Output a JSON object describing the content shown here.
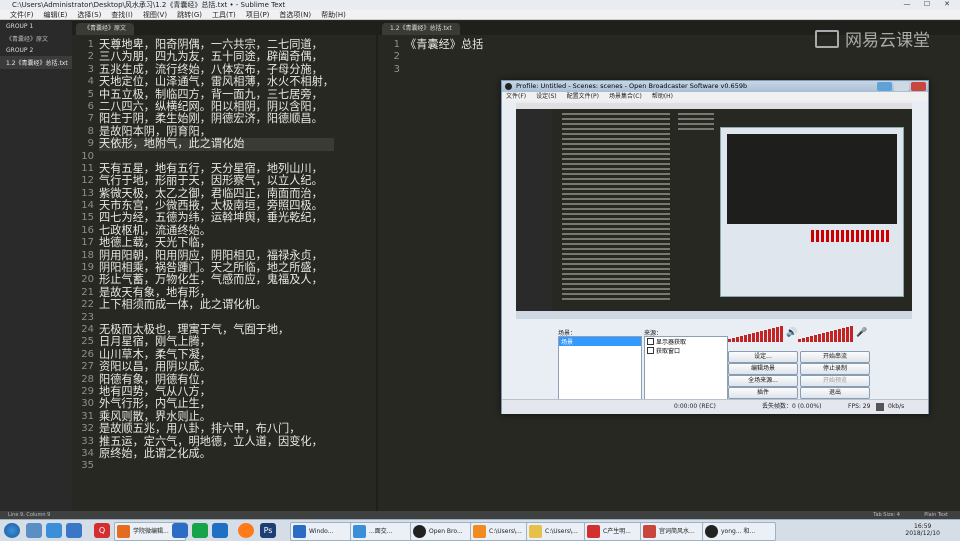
{
  "window": {
    "title": "C:\\Users\\Administrator\\Desktop\\风水承习\\1.2《青囊经》总括.txt • - Sublime Text",
    "controls": [
      "—",
      "☐",
      "✕"
    ]
  },
  "menubar": {
    "items": [
      "文件(F)",
      "编辑(E)",
      "选择(S)",
      "查找(I)",
      "视图(V)",
      "跳转(G)",
      "工具(T)",
      "项目(P)",
      "首选项(N)",
      "帮助(H)"
    ]
  },
  "sidebar": {
    "group1": "GROUP 1",
    "group1_item": "《青囊经》原文",
    "group2": "GROUP 2",
    "group2_item": "1.2《青囊经》总括.txt"
  },
  "left_pane": {
    "tab": "《青囊经》原文",
    "line_numbers": [
      "1",
      "2",
      "3",
      "4",
      "5",
      "6",
      "7",
      "8",
      "9",
      "10",
      "11",
      "12",
      "13",
      "14",
      "15",
      "16",
      "17",
      "18",
      "19",
      "20",
      "21",
      "22",
      "23",
      "24",
      "25",
      "26",
      "27",
      "28",
      "29",
      "30",
      "31",
      "32",
      "33",
      "34",
      "35"
    ],
    "lines": [
      "天尊地卑，阳奇阴偶，一六共宗，二七同道，",
      "三八为朋，四九为友，五十同途，辟阖奇偶，",
      "五兆生成，流行终始，八体宏布，子母分施，",
      "天地定位，山泽通气，雷风相薄，水火不相射，",
      "中五立极，制临四方，背一面九，三七居旁，",
      "二八四六，纵横纪网。阳以相阴，阴以含阳，",
      "阳生于阴，柔生始刚，阴德宏济，阳德顺昌。",
      "是故阳本阴，阴育阳，",
      "天依形，地附气，此之谓化始",
      "",
      "天有五星，地有五行，天分星宿，地列山川，",
      "气行于地，形丽于天，因形察气，以立人纪。",
      "紫微天极，太乙之御，君临四正，南面而治，",
      "天市东宫，少微西掖，太极南垣，旁照四极。",
      "四七为经，五德为纬，运斡坤舆，垂光乾纪，",
      "七政枢机，流通终始。",
      "地德上载，天光下临，",
      "阴用阳朝，阳用阴应，阴阳相见，福禄永贞，",
      "阴阳相乘，祸咎踵门。天之所临，地之所盛，",
      "形止气蓄，万物化生，气感而应，鬼福及人，",
      "是故天有象，地有形，",
      "上下相须而成一体，此之谓化机。",
      "",
      "无极而太极也，理寓于气，气囿于地，",
      "日月星宿，刚气上腾，",
      "山川草木，柔气下凝，",
      "资阳以昌，用阴以成。",
      "阳德有象，阴德有位，",
      "地有四势，气从八方，",
      "外气行形，内气止生，",
      "乘风则散，界水则止。",
      "是故顺五兆，用八卦，排六甲，布八门，",
      "推五运，定六气，明地德，立人道，因变化，",
      "原终始，此谓之化成。",
      ""
    ]
  },
  "right_pane": {
    "tab": "1.2《青囊经》总括.txt",
    "line_numbers": [
      "1",
      "2",
      "3"
    ],
    "lines": [
      "《青囊经》总括",
      "",
      ""
    ]
  },
  "watermark": "网易云课堂",
  "obs": {
    "title": "Profile: Untitled - Scenes: scenes - Open Broadcaster Software v0.659b",
    "menu": [
      "文件(F)",
      "设定(S)",
      "配置文件(P)",
      "场景集合(C)",
      "帮助(H)"
    ],
    "scenes_label": "场景：",
    "scenes": [
      "场景"
    ],
    "sources_label": "来源：",
    "sources": [
      "显示器获取",
      "获取窗口"
    ],
    "buttons": [
      "设定...",
      "开始串流",
      "编辑场景",
      "停止录制",
      "全场来源...",
      "开始预览",
      "插件",
      "退出"
    ],
    "status": {
      "time": "0:00:00 (REC)",
      "dropped": "丢失帧数：0 (0.00%)",
      "fps": "FPS: 29",
      "kbps": "0kb/s"
    }
  },
  "statusbar": {
    "left": "Line 9, Column 9",
    "tab_size": "Tab Size: 4",
    "syntax": "Plain Text"
  },
  "taskbar": {
    "tasks": [
      "学院微编辑...",
      "Windo...",
      "...面交...",
      "Open Bro...",
      "C:\\Users\\...",
      "C:\\Users\\...",
      "C产生明...",
      "宫词简风水...",
      "yong... 和..."
    ],
    "clock_time": "16:59",
    "clock_date": "2018/12/10"
  },
  "colors": {
    "editor_bg": "#272822",
    "text": "#e8e8e2",
    "gutter": "#8f908a",
    "obs_bg": "#e8eef4",
    "meter": "#c42323"
  }
}
